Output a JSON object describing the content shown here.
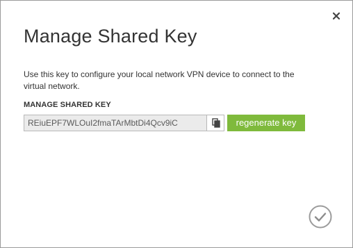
{
  "dialog": {
    "title": "Manage Shared Key",
    "description": "Use this key to configure your local network VPN device to connect to the virtual network.",
    "section_label": "MANAGE SHARED KEY",
    "shared_key": "REiuEPF7WLOuI2fmaTArMbtDi4Qcv9iC",
    "regenerate_label": "regenerate key"
  },
  "icons": {
    "close": "close-icon",
    "copy": "copy-icon",
    "ok": "checkmark-circle-icon"
  },
  "colors": {
    "accent_green": "#7fba3c",
    "text": "#333333",
    "input_background": "#ebebeb"
  }
}
